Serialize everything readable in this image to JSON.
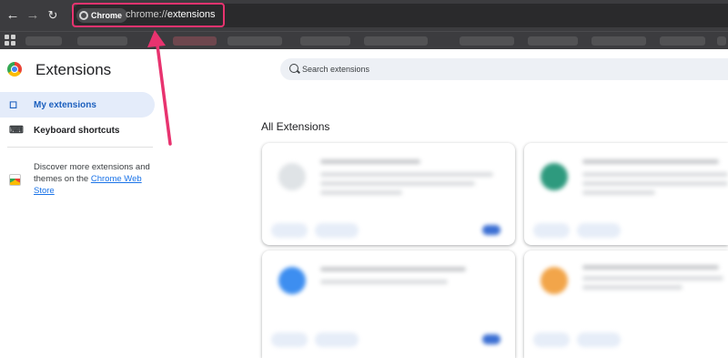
{
  "toolbar": {
    "back_icon": "arrow-left-icon",
    "forward_icon": "arrow-right-icon",
    "reload_icon": "reload-icon",
    "site_chip": "Chrome",
    "url_scheme": "chrome://",
    "url_host": "extensions"
  },
  "sidebar": {
    "title": "Extensions",
    "items": [
      {
        "label": "My extensions",
        "icon": "puzzle-icon",
        "active": true
      },
      {
        "label": "Keyboard shortcuts",
        "icon": "keyboard-icon",
        "active": false
      }
    ],
    "discover_text": "Discover more extensions and themes on the ",
    "store_link": "Chrome Web Store"
  },
  "search": {
    "placeholder": "Search extensions"
  },
  "main": {
    "section_title": "All Extensions"
  },
  "colors": {
    "highlight": "#e8336f",
    "accent": "#1a73e8",
    "toolbar_bg": "#3c3c3f"
  }
}
